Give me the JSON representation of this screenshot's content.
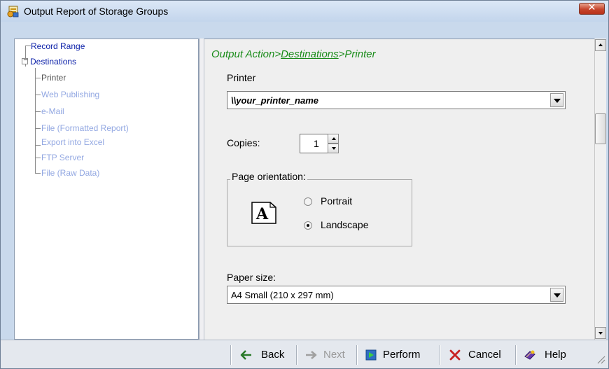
{
  "window": {
    "title": "Output Report of Storage Groups",
    "close_label": "✕"
  },
  "tree": {
    "items": [
      {
        "label": "Record Range"
      },
      {
        "label": "Destinations",
        "expander": "−"
      },
      {
        "label": "Printer"
      },
      {
        "label": "Web Publishing"
      },
      {
        "label": "e-Mail"
      },
      {
        "label": "File (Formatted Report)"
      },
      {
        "label": "Export into Excel"
      },
      {
        "label": "FTP Server"
      },
      {
        "label": "File (Raw Data)"
      }
    ]
  },
  "breadcrumb": {
    "part1": "Output Action>",
    "part2": "Destinations",
    "part3": ">Printer"
  },
  "printer": {
    "label": "Printer",
    "value": "\\\\your_printer_name"
  },
  "copies": {
    "label": "Copies:",
    "value": "1"
  },
  "orientation": {
    "legend": "Page orientation:",
    "icon_letter": "A",
    "options": [
      {
        "label": "Portrait",
        "selected": false
      },
      {
        "label": "Landscape",
        "selected": true
      }
    ]
  },
  "paper": {
    "label": "Paper size:",
    "value": "A4 Small (210 x 297 mm)"
  },
  "toolbar": {
    "back": "Back",
    "next": "Next",
    "perform": "Perform",
    "cancel": "Cancel",
    "help": "Help"
  },
  "colors": {
    "tree_top": "#0a1fa8",
    "tree_sub": "#93a8e2",
    "breadcrumb": "#1a8c1a",
    "close_button": "#c7452c"
  }
}
